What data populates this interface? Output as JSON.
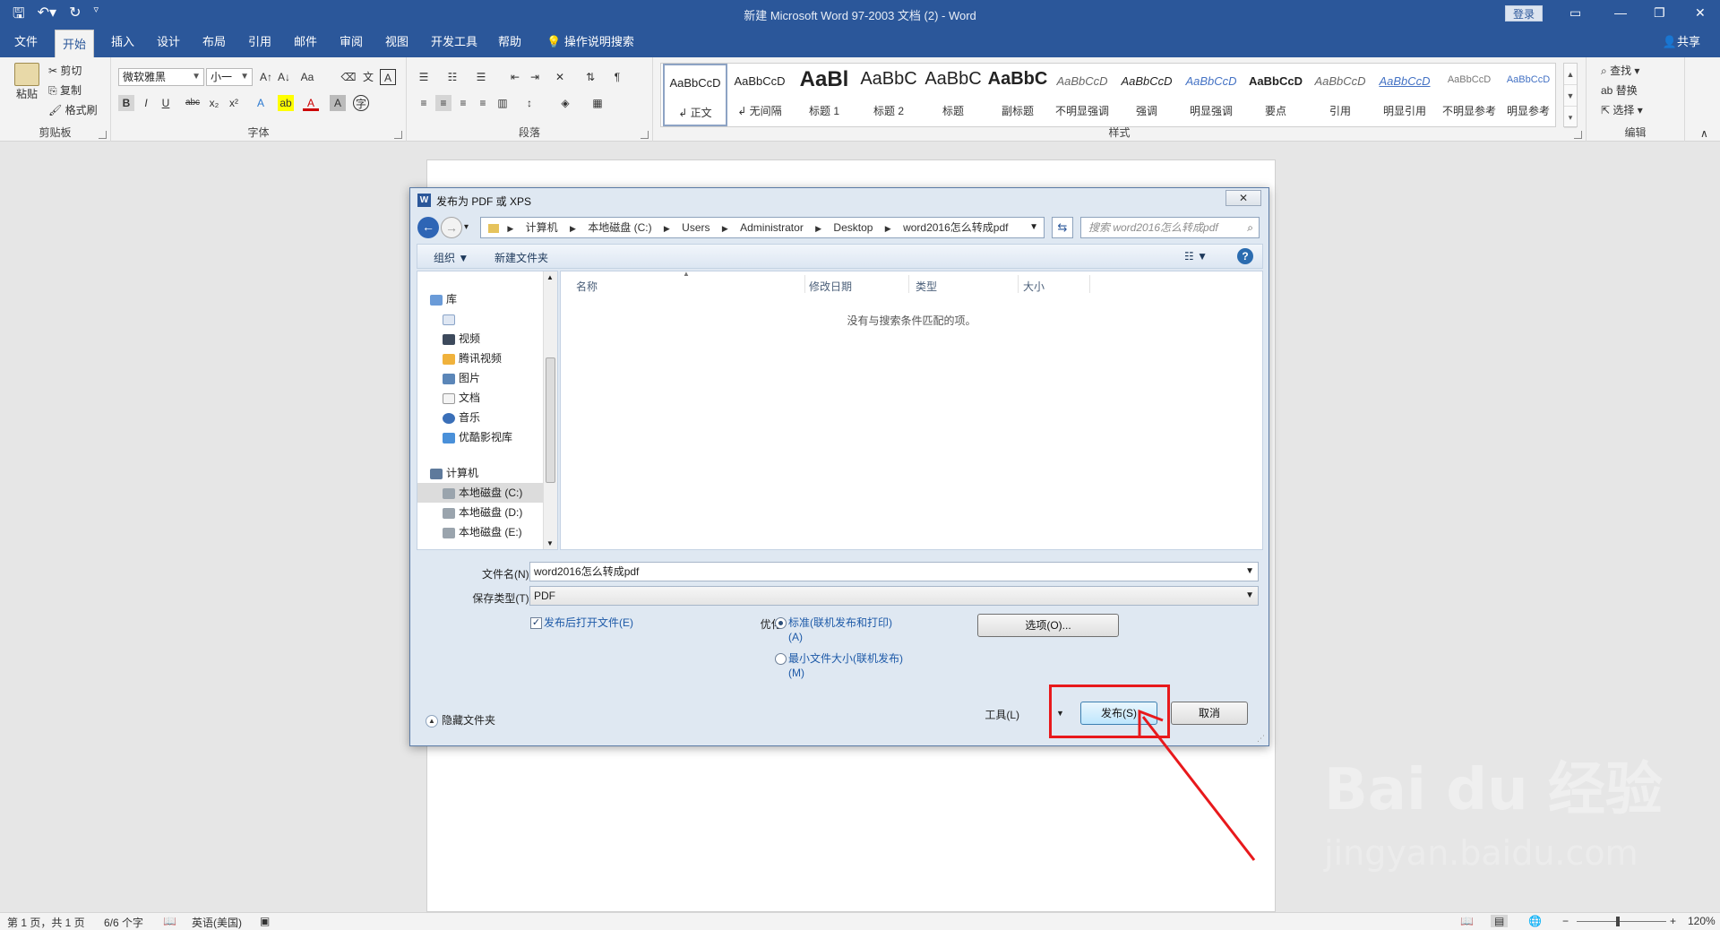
{
  "titlebar": {
    "title": "新建 Microsoft Word 97-2003 文档 (2)  -  Word",
    "login": "登录"
  },
  "tabs": [
    "文件",
    "开始",
    "插入",
    "设计",
    "布局",
    "引用",
    "邮件",
    "审阅",
    "视图",
    "开发工具",
    "帮助"
  ],
  "tell_me": "操作说明搜索",
  "share": "共享",
  "ribbon": {
    "clipboard": {
      "paste": "粘贴",
      "cut": "剪切",
      "copy": "复制",
      "format_painter": "格式刷",
      "label": "剪贴板"
    },
    "font": {
      "name": "微软雅黑",
      "size": "小一",
      "label": "字体"
    },
    "paragraph": {
      "label": "段落"
    },
    "styles": {
      "label": "样式",
      "items": [
        {
          "sample": "AaBbCcD",
          "name": "↲ 正文"
        },
        {
          "sample": "AaBbCcD",
          "name": "↲ 无间隔"
        },
        {
          "sample": "AaBl",
          "name": "标题 1"
        },
        {
          "sample": "AaBbC",
          "name": "标题 2"
        },
        {
          "sample": "AaBbC",
          "name": "标题"
        },
        {
          "sample": "AaBbC",
          "name": "副标题"
        },
        {
          "sample": "AaBbCcD",
          "name": "不明显强调"
        },
        {
          "sample": "AaBbCcD",
          "name": "强调"
        },
        {
          "sample": "AaBbCcD",
          "name": "明显强调"
        },
        {
          "sample": "AaBbCcD",
          "name": "要点"
        },
        {
          "sample": "AaBbCcD",
          "name": "引用"
        },
        {
          "sample": "AaBbCcD",
          "name": "明显引用"
        },
        {
          "sample": "AaBbCcD",
          "name": "不明显参考"
        },
        {
          "sample": "AaBbCcD",
          "name": "明显参考"
        }
      ]
    },
    "editing": {
      "find": "查找",
      "replace": "替换",
      "select": "选择",
      "label": "编辑"
    }
  },
  "dialog": {
    "title": "发布为 PDF 或 XPS",
    "breadcrumbs": [
      "计算机",
      "本地磁盘 (C:)",
      "Users",
      "Administrator",
      "Desktop",
      "word2016怎么转成pdf"
    ],
    "search_placeholder": "搜索 word2016怎么转成pdf",
    "organize": "组织",
    "new_folder": "新建文件夹",
    "nav": [
      {
        "label": "库",
        "icon": "library-icon",
        "level": 0
      },
      {
        "label": "",
        "icon": "document-icon",
        "level": 1
      },
      {
        "label": "视频",
        "icon": "video-icon",
        "level": 1
      },
      {
        "label": "腾讯视频",
        "icon": "folder-icon",
        "level": 1
      },
      {
        "label": "图片",
        "icon": "picture-icon",
        "level": 1
      },
      {
        "label": "文档",
        "icon": "document-icon",
        "level": 1
      },
      {
        "label": "音乐",
        "icon": "music-icon",
        "level": 1
      },
      {
        "label": "优酷影视库",
        "icon": "folder-icon",
        "level": 1
      },
      {
        "label": "计算机",
        "icon": "computer-icon",
        "level": 0
      },
      {
        "label": "本地磁盘 (C:)",
        "icon": "drive-icon",
        "level": 1
      },
      {
        "label": "本地磁盘 (D:)",
        "icon": "drive-icon",
        "level": 1
      },
      {
        "label": "本地磁盘 (E:)",
        "icon": "drive-icon",
        "level": 1
      }
    ],
    "columns": [
      "名称",
      "修改日期",
      "类型",
      "大小"
    ],
    "empty_message": "没有与搜索条件匹配的项。",
    "filename_label": "文件名(N):",
    "filename": "word2016怎么转成pdf",
    "filetype_label": "保存类型(T):",
    "filetype": "PDF",
    "open_after": "发布后打开文件(E)",
    "optimize_label": "优化:",
    "opt_standard": "标准(联机发布和打印)(A)",
    "opt_minimum": "最小文件大小(联机发布)(M)",
    "options_btn": "选项(O)...",
    "hide_folders": "隐藏文件夹",
    "tools": "工具(L)",
    "publish": "发布(S)",
    "cancel": "取消"
  },
  "status": {
    "page": "第 1 页，共 1 页",
    "words": "6/6 个字",
    "language": "英语(美国)",
    "zoom": "120%"
  },
  "watermark": {
    "big": "Bai du 经验",
    "small": "jingyan.baidu.com"
  }
}
